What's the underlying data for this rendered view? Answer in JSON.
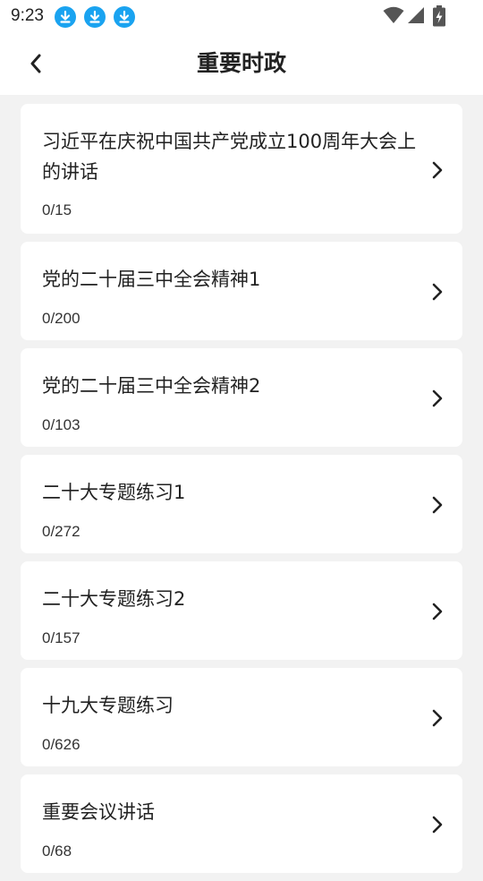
{
  "status_bar": {
    "time": "9:23",
    "notification_icons": [
      "download-icon",
      "download-icon",
      "download-icon"
    ],
    "system_icons": [
      "wifi-icon",
      "signal-icon",
      "battery-charging-icon"
    ],
    "accent_color": "#1aa3f0"
  },
  "header": {
    "title": "重要时政",
    "back_icon": "chevron-left-icon"
  },
  "items": [
    {
      "title": "习近平在庆祝中国共产党成立100周年大会上的讲话",
      "count": "0/15"
    },
    {
      "title": "党的二十届三中全会精神1",
      "count": "0/200"
    },
    {
      "title": "党的二十届三中全会精神2",
      "count": "0/103"
    },
    {
      "title": "二十大专题练习1",
      "count": "0/272"
    },
    {
      "title": "二十大专题练习2",
      "count": "0/157"
    },
    {
      "title": "十九大专题练习",
      "count": "0/626"
    },
    {
      "title": "重要会议讲话",
      "count": "0/68"
    }
  ],
  "colors": {
    "background": "#f2f2f2",
    "card": "#ffffff",
    "text": "#222222"
  }
}
